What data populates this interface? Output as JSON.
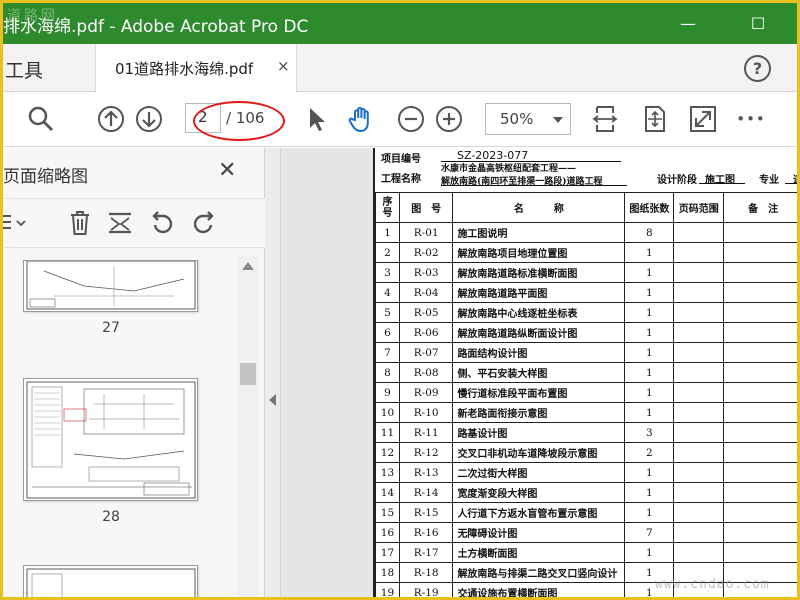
{
  "window": {
    "title": "排水海绵.pdf - Adobe Acrobat Pro DC",
    "watermark_tl": "道路网",
    "minimize": "—",
    "maximize": "☐"
  },
  "tabs": {
    "tools": "工具",
    "doc": "01道路排水海绵.pdf",
    "close": "×",
    "help": "?"
  },
  "toolbar": {
    "page_current": "2",
    "page_total": "/ 106",
    "zoom": "50%",
    "more": "•••"
  },
  "panel": {
    "title": "页面缩略图",
    "close": "✕",
    "thumb_numbers": [
      "27",
      "28"
    ]
  },
  "document": {
    "project_no_label": "项目编号",
    "project_no": "SZ-2023-077",
    "project_name_label": "工程名称",
    "project_name_line1": "水康市金晶高铁枢纽配套工程——",
    "project_name_line2": "解放南路(南四环至排渠一路段)道路工程",
    "design_stage_label": "设计阶段",
    "design_stage": "施工图",
    "major_label": "专业",
    "major_value": "道",
    "columns": [
      "序号",
      "图　号",
      "名　　　称",
      "图纸张数",
      "页码范围",
      "备　注"
    ],
    "rows": [
      {
        "no": "1",
        "code": "R-01",
        "name": "施工图说明",
        "sheets": "8"
      },
      {
        "no": "2",
        "code": "R-02",
        "name": "解放南路项目地理位置图",
        "sheets": "1"
      },
      {
        "no": "3",
        "code": "R-03",
        "name": "解放南路道路标准横断面图",
        "sheets": "1"
      },
      {
        "no": "4",
        "code": "R-04",
        "name": "解放南路道路平面图",
        "sheets": "1"
      },
      {
        "no": "5",
        "code": "R-05",
        "name": "解放南路中心线逐桩坐标表",
        "sheets": "1"
      },
      {
        "no": "6",
        "code": "R-06",
        "name": "解放南路道路纵断面设计图",
        "sheets": "1"
      },
      {
        "no": "7",
        "code": "R-07",
        "name": "路面结构设计图",
        "sheets": "1"
      },
      {
        "no": "8",
        "code": "R-08",
        "name": "侧、平石安装大样图",
        "sheets": "1"
      },
      {
        "no": "9",
        "code": "R-09",
        "name": "慢行道标准段平面布置图",
        "sheets": "1"
      },
      {
        "no": "10",
        "code": "R-10",
        "name": "新老路面衔接示意图",
        "sheets": "1"
      },
      {
        "no": "11",
        "code": "R-11",
        "name": "路基设计图",
        "sheets": "3"
      },
      {
        "no": "12",
        "code": "R-12",
        "name": "交叉口非机动车道降坡段示意图",
        "sheets": "2"
      },
      {
        "no": "13",
        "code": "R-13",
        "name": "二次过街大样图",
        "sheets": "1"
      },
      {
        "no": "14",
        "code": "R-14",
        "name": "宽度渐变段大样图",
        "sheets": "1"
      },
      {
        "no": "15",
        "code": "R-15",
        "name": "人行道下方返水盲管布置示意图",
        "sheets": "1"
      },
      {
        "no": "16",
        "code": "R-16",
        "name": "无障碍设计图",
        "sheets": "7"
      },
      {
        "no": "17",
        "code": "R-17",
        "name": "土方横断面图",
        "sheets": "1"
      },
      {
        "no": "18",
        "code": "R-18",
        "name": "解放南路与排渠二路交叉口竖向设计",
        "sheets": "1"
      },
      {
        "no": "19",
        "code": "R-19",
        "name": "交通设施布置横断面图",
        "sheets": "1"
      }
    ]
  },
  "watermark_br": "www.cndao.com",
  "colors": {
    "titlebar": "#2d8a2d",
    "frame": "#e8c020",
    "annotation": "#e01818",
    "hand_tool": "#1a6fc4"
  }
}
